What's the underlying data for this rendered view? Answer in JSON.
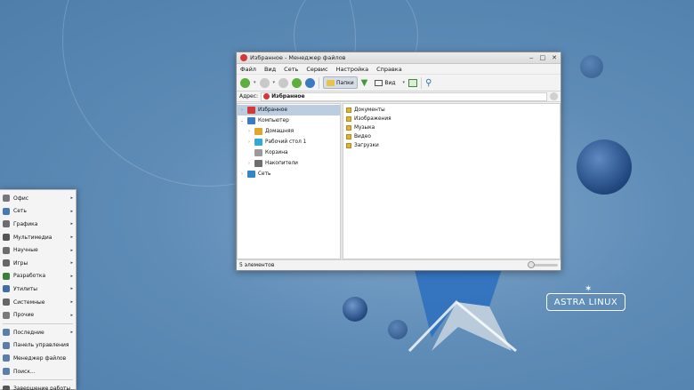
{
  "window": {
    "title": "Избранное - Менеджер файлов",
    "menu": [
      "Файл",
      "Вид",
      "Сеть",
      "Сервис",
      "Настройка",
      "Справка"
    ],
    "toolbar": {
      "folders_label": "Папки",
      "view_label": "Вид"
    },
    "address": {
      "label": "Адрес:",
      "value": "Избранное"
    },
    "tree": [
      {
        "label": "Избранное",
        "icon": "heart-icon",
        "indent": 0,
        "expander": "›",
        "selected": true
      },
      {
        "label": "Компьютер",
        "icon": "computer-icon",
        "indent": 0,
        "expander": "⌄",
        "selected": false
      },
      {
        "label": "Домашняя",
        "icon": "home-icon",
        "indent": 1,
        "expander": "›",
        "selected": false
      },
      {
        "label": "Рабочий стол 1",
        "icon": "desktop-icon",
        "indent": 1,
        "expander": "›",
        "selected": false
      },
      {
        "label": "Корзина",
        "icon": "trash-icon",
        "indent": 1,
        "expander": "",
        "selected": false
      },
      {
        "label": "Накопители",
        "icon": "drives-icon",
        "indent": 1,
        "expander": "›",
        "selected": false
      },
      {
        "label": "Сеть",
        "icon": "network-icon",
        "indent": 0,
        "expander": "›",
        "selected": false
      }
    ],
    "files": [
      "Документы",
      "Изображения",
      "Музыка",
      "Видео",
      "Загрузки"
    ],
    "status": "5 элементов"
  },
  "start_menu": {
    "items": [
      {
        "label": "Офис",
        "submenu": true
      },
      {
        "label": "Сеть",
        "submenu": true
      },
      {
        "label": "Графика",
        "submenu": true
      },
      {
        "label": "Мультимедиа",
        "submenu": true
      },
      {
        "label": "Научные",
        "submenu": true
      },
      {
        "label": "Игры",
        "submenu": true
      },
      {
        "label": "Разработка",
        "submenu": true
      },
      {
        "label": "Утилиты",
        "submenu": true
      },
      {
        "label": "Системные",
        "submenu": true
      },
      {
        "label": "Прочие",
        "submenu": true
      }
    ],
    "bottom_items": [
      {
        "label": "Последние",
        "submenu": true
      },
      {
        "label": "Панель управления",
        "submenu": false
      },
      {
        "label": "Менеджер файлов",
        "submenu": false
      },
      {
        "label": "Поиск...",
        "submenu": false
      }
    ],
    "logout": "Завершение работы..."
  },
  "brand": {
    "logo_text": "ASTRA LINUX"
  }
}
